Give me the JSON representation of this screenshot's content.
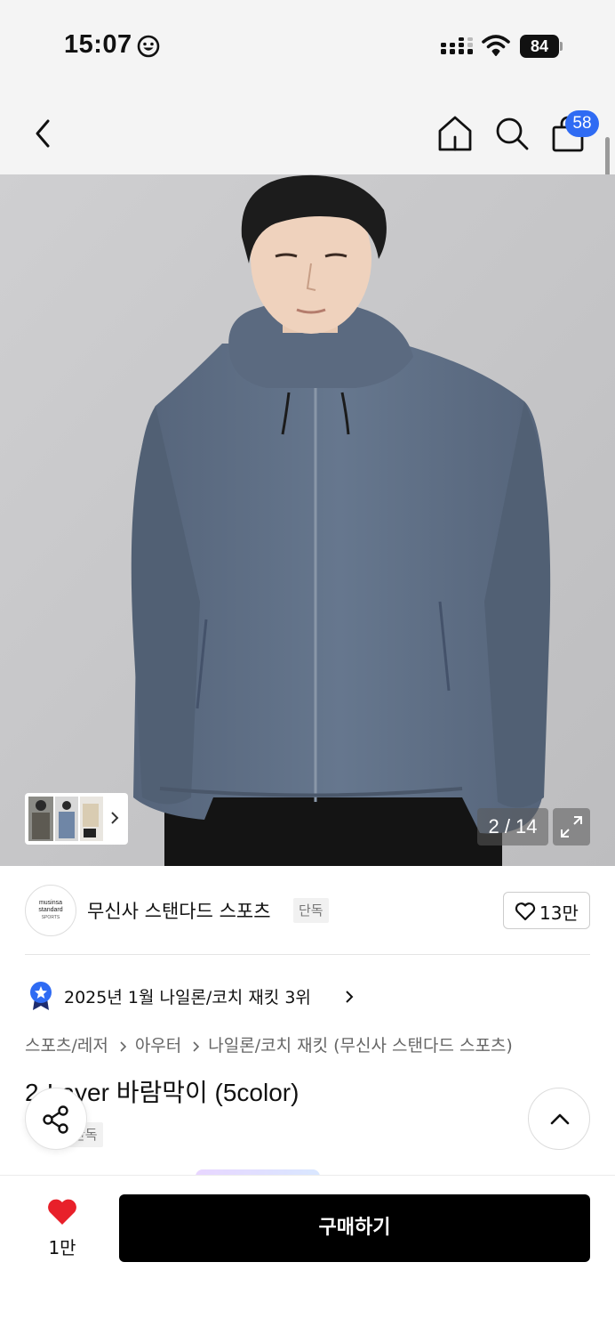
{
  "status_bar": {
    "time": "15:07",
    "battery": "84",
    "icons": [
      "smiley-icon",
      "signal-icon",
      "wifi-icon",
      "battery-icon"
    ]
  },
  "app_bar": {
    "icons": [
      "back-icon",
      "home-icon",
      "search-icon",
      "shopping-bag-icon"
    ],
    "cart_count": "58"
  },
  "gallery": {
    "counter": "2 / 14",
    "icons": [
      "expand-icon",
      "chevron-right-icon"
    ]
  },
  "brand": {
    "logo_line1": "musinsa",
    "logo_line2": "standard",
    "logo_line3": "SPORTS",
    "name": "무신사 스탠다드 스포츠",
    "tag": "단독",
    "likes": "13만"
  },
  "ranking": {
    "text": "2025년 1월 나일론/코치 재킷 3위",
    "icon": "award-badge-icon"
  },
  "breadcrumb": {
    "items": [
      "스포츠/레저",
      "아우터",
      "나일론/코치 재킷 (무신사 스탠다드 스포츠)"
    ]
  },
  "product": {
    "title": "2-Layer 바람막이 (5color)",
    "tag": "단독"
  },
  "bottom_bar": {
    "wish_count": "1만",
    "buy_label": "구매하기"
  },
  "colors": {
    "badge_blue": "#2f6bf3",
    "heart_red": "#e8202a",
    "buy_black": "#000000",
    "jacket": "#5f6f85"
  }
}
